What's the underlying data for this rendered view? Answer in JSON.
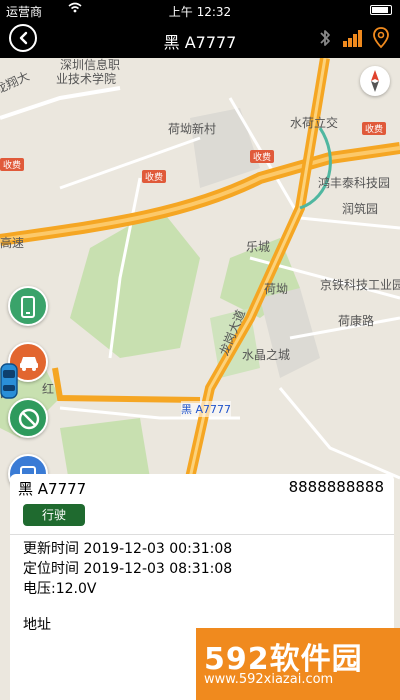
{
  "status_bar": {
    "carrier": "运营商",
    "time": "上午 12:32"
  },
  "nav": {
    "title": "黑 A7777",
    "back_icon": "back-arrow-icon",
    "bluetooth_icon": "bluetooth-icon",
    "signal_icon": "signal-bars-icon",
    "location_icon": "location-pin-icon"
  },
  "map": {
    "labels": {
      "school": "深圳信息职",
      "school2": "业技术学院",
      "road_longxiang": "龙翔大",
      "hekan_village": "荷坳新村",
      "shuihe_interchange": "水荷立交",
      "hongfengtai": "鸿丰泰科技园",
      "runzhu": "润筑园",
      "lecheng": "乐城",
      "hekan_station": "荷坳",
      "jingtie": "京铁科技工业园",
      "hekang_road": "荷康路",
      "shuijing": "水晶之城",
      "longgang_road": "龙岗大道",
      "expressway": "高速",
      "hong": "红",
      "yuan": "园"
    },
    "toll_label": "收费",
    "compass_label": "北"
  },
  "side_buttons": {
    "phone": "phone-icon",
    "car": "car-icon",
    "fence": "no-entry-icon",
    "more": "device-icon"
  },
  "vehicle": {
    "marker_label": "黑 A7777"
  },
  "panel": {
    "plate": "黑 A7777",
    "phone": "8888888888",
    "status": "行驶",
    "update_time": "更新时间 2019-12-03 00:31:08",
    "locate_time": "定位时间 2019-12-03 08:31:08",
    "voltage": "电压:12.0V",
    "address": "地址"
  },
  "watermark": {
    "main": "592软件园",
    "url": "www.592xiazai.com"
  }
}
